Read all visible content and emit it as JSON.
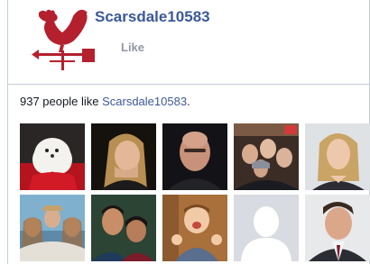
{
  "page": {
    "name": "Scarsdale10583",
    "like_label": "Like"
  },
  "likes_summary": {
    "count_text": "937 people like",
    "page_link": "Scarsdale10583",
    "trailing": "."
  },
  "colors": {
    "brand_blue": "#3b5998",
    "rooster_red": "#b5202e",
    "muted_gray": "#9197a3"
  },
  "friends": [
    {
      "avatar": "white-dog-photo"
    },
    {
      "avatar": "blonde-woman-photo"
    },
    {
      "avatar": "bald-man-photo"
    },
    {
      "avatar": "group-night-photo"
    },
    {
      "avatar": "blonde-woman-portrait"
    },
    {
      "avatar": "three-women-photo"
    },
    {
      "avatar": "couple-photo"
    },
    {
      "avatar": "baby-photo"
    },
    {
      "avatar": "default-silhouette"
    },
    {
      "avatar": "man-suit-portrait"
    }
  ]
}
